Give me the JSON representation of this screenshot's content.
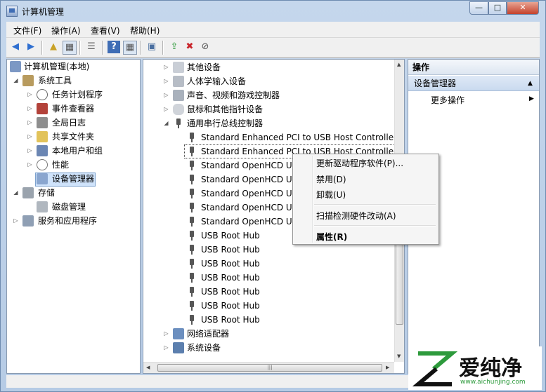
{
  "window": {
    "title": "计算机管理"
  },
  "title_controls": {
    "minimize": "—",
    "maximize": "□",
    "close": "✕"
  },
  "menu": [
    "文件(F)",
    "操作(A)",
    "查看(V)",
    "帮助(H)"
  ],
  "left_tree": [
    {
      "label": "计算机管理(本地)",
      "icon": "computer-management-icon",
      "expand": "",
      "depth": 0
    },
    {
      "label": "系统工具",
      "icon": "system-tools-icon",
      "expand": "◢",
      "depth": 1
    },
    {
      "label": "任务计划程序",
      "icon": "clock-icon",
      "expand": "▷",
      "depth": 2
    },
    {
      "label": "事件查看器",
      "icon": "event-viewer-icon",
      "expand": "▷",
      "depth": 2
    },
    {
      "label": "全局日志",
      "icon": "log-icon",
      "expand": "▷",
      "depth": 2
    },
    {
      "label": "共享文件夹",
      "icon": "shared-folder-icon",
      "expand": "▷",
      "depth": 2
    },
    {
      "label": "本地用户和组",
      "icon": "users-icon",
      "expand": "▷",
      "depth": 2
    },
    {
      "label": "性能",
      "icon": "performance-icon",
      "expand": "▷",
      "depth": 2
    },
    {
      "label": "设备管理器",
      "icon": "device-manager-icon",
      "expand": "",
      "depth": 2
    },
    {
      "label": "存储",
      "icon": "storage-icon",
      "expand": "◢",
      "depth": 1
    },
    {
      "label": "磁盘管理",
      "icon": "disk-icon",
      "expand": "",
      "depth": 2
    },
    {
      "label": "服务和应用程序",
      "icon": "services-icon",
      "expand": "▷",
      "depth": 1
    }
  ],
  "device_tree": [
    {
      "label": "其他设备",
      "icon": "other-devices-icon",
      "expand": "▷",
      "depth": 0
    },
    {
      "label": "人体学输入设备",
      "icon": "hid-icon",
      "expand": "▷",
      "depth": 0
    },
    {
      "label": "声音、视频和游戏控制器",
      "icon": "sound-icon",
      "expand": "▷",
      "depth": 0
    },
    {
      "label": "鼠标和其他指针设备",
      "icon": "mouse-icon",
      "expand": "▷",
      "depth": 0
    },
    {
      "label": "通用串行总线控制器",
      "icon": "usb-icon",
      "expand": "◢",
      "depth": 0
    },
    {
      "label": "Standard Enhanced PCI to USB Host Controller",
      "icon": "usb-icon",
      "expand": "",
      "depth": 1
    },
    {
      "label": "Standard Enhanced PCI to USB Host Controller",
      "icon": "usb-icon",
      "expand": "",
      "depth": 1
    },
    {
      "label": "Standard OpenHCD US",
      "icon": "usb-icon",
      "expand": "",
      "depth": 1
    },
    {
      "label": "Standard OpenHCD US",
      "icon": "usb-icon",
      "expand": "",
      "depth": 1
    },
    {
      "label": "Standard OpenHCD US",
      "icon": "usb-icon",
      "expand": "",
      "depth": 1
    },
    {
      "label": "Standard OpenHCD US",
      "icon": "usb-icon",
      "expand": "",
      "depth": 1
    },
    {
      "label": "Standard OpenHCD US",
      "icon": "usb-icon",
      "expand": "",
      "depth": 1
    },
    {
      "label": "USB Root Hub",
      "icon": "usb-icon",
      "expand": "",
      "depth": 1
    },
    {
      "label": "USB Root Hub",
      "icon": "usb-icon",
      "expand": "",
      "depth": 1
    },
    {
      "label": "USB Root Hub",
      "icon": "usb-icon",
      "expand": "",
      "depth": 1
    },
    {
      "label": "USB Root Hub",
      "icon": "usb-icon",
      "expand": "",
      "depth": 1
    },
    {
      "label": "USB Root Hub",
      "icon": "usb-icon",
      "expand": "",
      "depth": 1
    },
    {
      "label": "USB Root Hub",
      "icon": "usb-icon",
      "expand": "",
      "depth": 1
    },
    {
      "label": "USB Root Hub",
      "icon": "usb-icon",
      "expand": "",
      "depth": 1
    },
    {
      "label": "网络适配器",
      "icon": "network-icon",
      "expand": "▷",
      "depth": 0
    },
    {
      "label": "系统设备",
      "icon": "system-devices-icon",
      "expand": "▷",
      "depth": 0
    }
  ],
  "actions_pane": {
    "header": "操作",
    "section": "设备管理器",
    "section_arrow": "▲",
    "more": "更多操作",
    "more_arrow": "▶"
  },
  "context_menu": {
    "update_driver": "更新驱动程序软件(P)...",
    "disable": "禁用(D)",
    "uninstall": "卸载(U)",
    "scan": "扫描检测硬件改动(A)",
    "properties": "属性(R)"
  },
  "watermark": {
    "brand": "爱纯净",
    "url": "www.aichunjing.com"
  },
  "colors": {
    "selection": "#cfe3fb",
    "accent": "#3f6db5",
    "brand_green": "#2d9a3c"
  }
}
